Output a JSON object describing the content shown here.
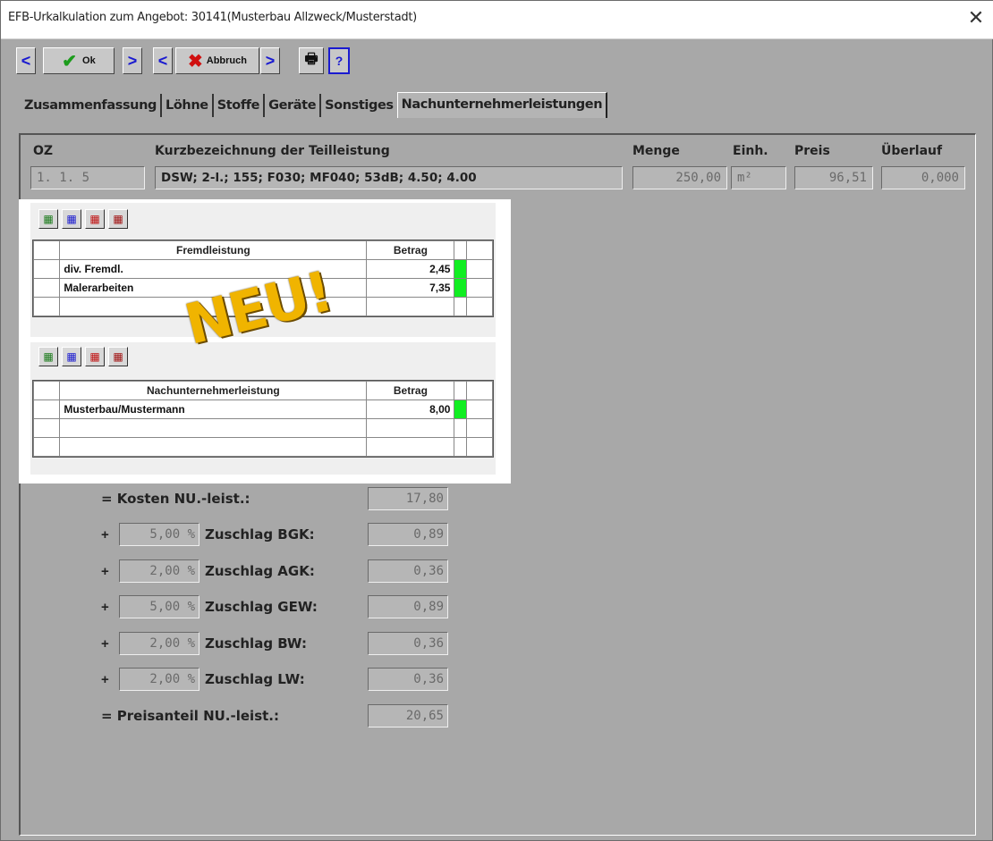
{
  "window": {
    "title": "EFB-Urkalkulation zum Angebot: 30141(Musterbau Allzweck/Musterstadt)",
    "close": "✕"
  },
  "toolbar": {
    "ok_label": "Ok",
    "abbruch_label": "Abbruch"
  },
  "tabs": [
    {
      "label": "Zusammenfassung"
    },
    {
      "label": "Löhne"
    },
    {
      "label": "Stoffe"
    },
    {
      "label": "Geräte"
    },
    {
      "label": "Sonstiges"
    },
    {
      "label": "Nachunternehmerleistungen",
      "active": true
    }
  ],
  "header": {
    "oz_label": "OZ",
    "kurz_label": "Kurzbezeichnung der Teilleistung",
    "menge_label": "Menge",
    "einh_label": "Einh.",
    "preis_label": "Preis",
    "ueber_label": "Überlauf",
    "oz": "1. 1.  5",
    "kurz": "DSW; 2-l.; 155; F030; MF040; 53dB; 4.50; 4.00",
    "menge": "250,00",
    "einh": "m²",
    "preis": "96,51",
    "ueber": "0,000"
  },
  "fremd": {
    "col1": "Fremdleistung",
    "col2": "Betrag",
    "rows": [
      {
        "name": "div. Fremdl.",
        "betrag": "2,45"
      },
      {
        "name": "Malerarbeiten",
        "betrag": "7,35"
      }
    ]
  },
  "neu_label": "NEU!",
  "nu": {
    "col1": "Nachunternehmerleistung",
    "col2": "Betrag",
    "rows": [
      {
        "name": "Musterbau/Mustermann",
        "betrag": "8,00"
      }
    ]
  },
  "calc": {
    "kosten_label": "= Kosten NU.-leist.:",
    "kosten": "17,80",
    "zuschlaege": [
      {
        "sign": "+",
        "pct": "5,00 %",
        "label": "Zuschlag BGK:",
        "value": "0,89"
      },
      {
        "sign": "+",
        "pct": "2,00 %",
        "label": "Zuschlag AGK:",
        "value": "0,36"
      },
      {
        "sign": "+",
        "pct": "5,00 %",
        "label": "Zuschlag GEW:",
        "value": "0,89"
      },
      {
        "sign": "+",
        "pct": "2,00 %",
        "label": "Zuschlag BW:",
        "value": "0,36"
      },
      {
        "sign": "+",
        "pct": "2,00 %",
        "label": "Zuschlag LW:",
        "value": "0,36"
      }
    ],
    "preis_label": "= Preisanteil NU.-leist.:",
    "preis": "20,65"
  },
  "colors": {
    "status_green": "#11ee22",
    "neu_yellow": "#f0b400"
  }
}
